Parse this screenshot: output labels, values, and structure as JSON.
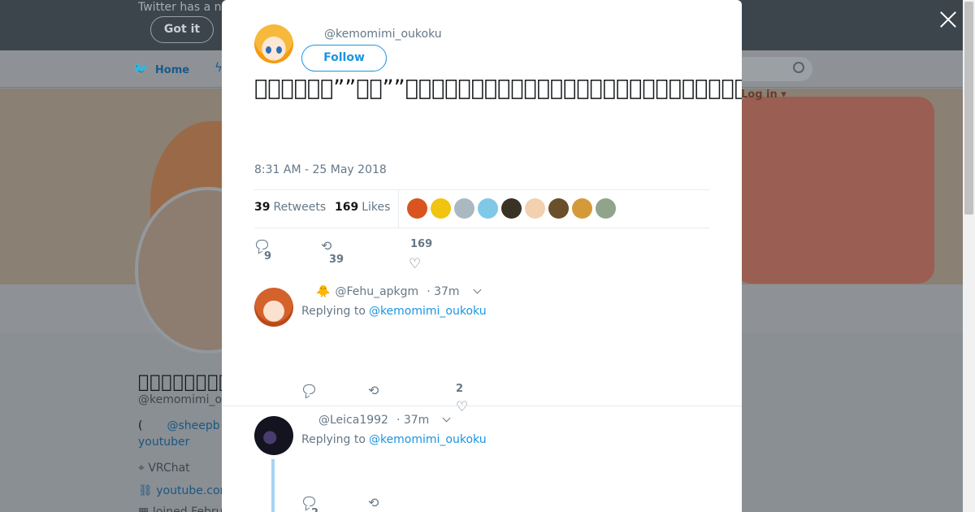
{
  "background": {
    "banner_text": "Twitter has a n",
    "got_it_label": "Got it",
    "nav_home_label": "Home",
    "login_label": "Log in",
    "profile_name": "\u0000\u0000\u0000\u0000\u0000\u0000\u0000\u0000\u0000\u0000\u0000\u0000",
    "profile_handle": "@kemomimi_o",
    "bio_prefix": "(",
    "bio_link": "@sheepb",
    "bio_youtuber": "youtuber",
    "location": "VRChat",
    "website": "youtube.cor",
    "joined": "Joined Febru"
  },
  "modal": {
    "author_handle": "@kemomimi_oukoku",
    "follow_label": "Follow",
    "tweet_text": "\u0000\u0000\u0000\u0000\u0000\u0000””\u0000\u0000””\u0000\u0000\u0000\u0000\u0000\u0000\u0000\u0000\u0000\u0000\u0000\u0000\u0000\u0000\u0000\u0000\u0000\u0000\u0000\u0000\u0000\u0000\u0000\u0000\u0000\u0000\u0000\u0000\u0000\u0000\u0000\u0000\u0000\u0000\u0000\u0000\u0000\u0000\u0000\u0000\u0000\u0000\u0000\u0000\u0000\u0000\u0000\u0000\u0000\u0000\u0000\u0000\u0000\u0000\u0000\u0000\u0000\u0000",
    "timestamp": "8:31 AM - 25 May 2018",
    "retweets_count": "39",
    "retweets_label": "Retweets",
    "likes_count": "169",
    "likes_label": "Likes",
    "likers": [
      "#d9541e",
      "#f1c40f",
      "#aab8c2",
      "#7fc8e8",
      "#3b3226",
      "#f2d0b0",
      "#6b4f2a",
      "#d49a3a",
      "#8fa48a"
    ],
    "actions": {
      "replies": "9",
      "retweets": "39",
      "likes": "169"
    }
  },
  "replies": [
    {
      "emoji": "🐥",
      "handle": "@Fehu_apkgm",
      "time": "· 37m",
      "replying_label": "Replying to",
      "replying_to": "@kemomimi_oukoku",
      "actions": {
        "replies": "",
        "retweets": "",
        "likes": "2"
      }
    },
    {
      "emoji": "",
      "handle": "@Leica1992",
      "time": "· 37m",
      "replying_label": "Replying to",
      "replying_to": "@kemomimi_oukoku",
      "actions": {
        "replies": "2",
        "retweets": "",
        "likes": ""
      }
    }
  ],
  "colors": {
    "accent": "#1b95e0",
    "muted": "#657786",
    "text": "#14171a"
  },
  "icons": [
    "close-icon",
    "reply-icon",
    "retweet-icon",
    "heart-icon",
    "chevron-down-icon"
  ]
}
